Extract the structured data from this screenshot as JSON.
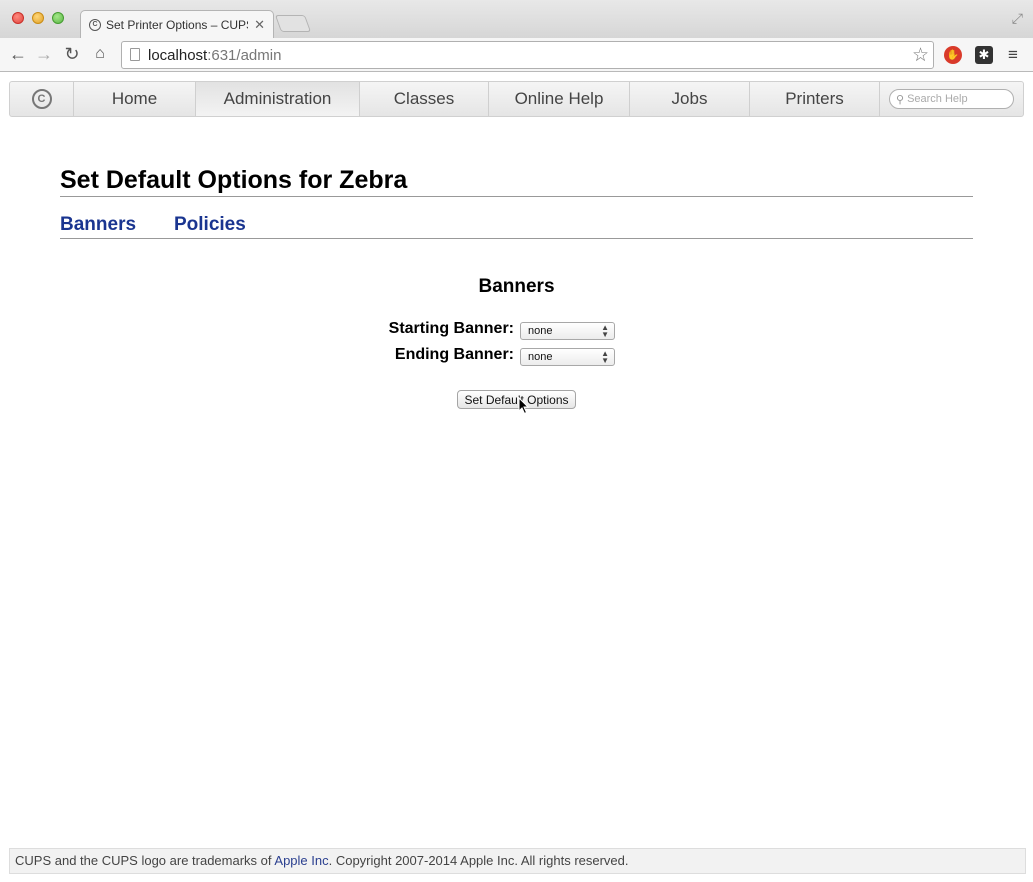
{
  "browser": {
    "tab_title": "Set Printer Options – CUPS",
    "url_host": "localhost",
    "url_path": ":631/admin"
  },
  "nav": {
    "items": [
      "Home",
      "Administration",
      "Classes",
      "Online Help",
      "Jobs",
      "Printers"
    ],
    "active": "Administration",
    "search_placeholder": "Search Help"
  },
  "page": {
    "title": "Set Default Options for Zebra",
    "subtabs": [
      "Banners",
      "Policies"
    ],
    "section_title": "Banners",
    "starting_banner_label": "Starting Banner:",
    "starting_banner_value": "none",
    "ending_banner_label": "Ending Banner:",
    "ending_banner_value": "none",
    "submit_label": "Set Default Options"
  },
  "footer": {
    "text_before": "CUPS and the CUPS logo are trademarks of ",
    "link_text": "Apple Inc",
    "text_after": ". Copyright 2007-2014 Apple Inc. All rights reserved."
  }
}
